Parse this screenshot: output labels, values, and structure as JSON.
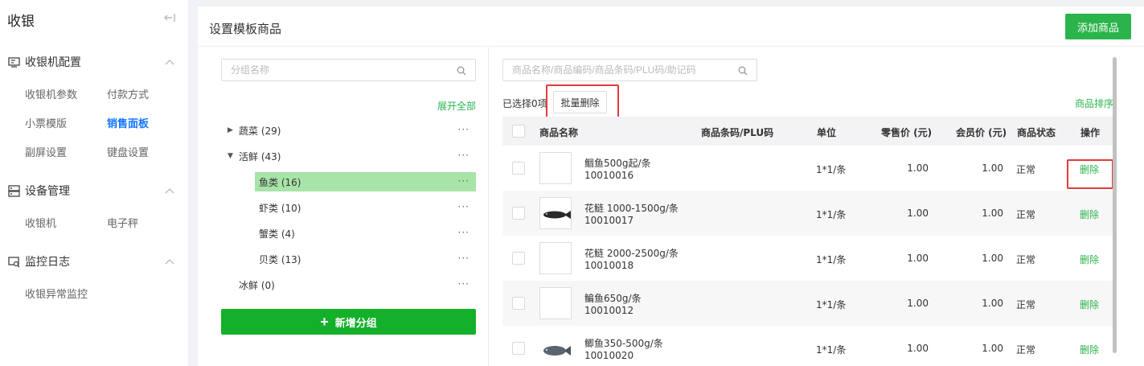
{
  "sidebar": {
    "title": "收银",
    "collapse_icon": "collapse-left-icon",
    "groups": [
      {
        "label": "收银机配置",
        "icon": "pos-config-icon",
        "items": [
          "收银机参数",
          "付款方式",
          "小票模版",
          "销售面板",
          "副屏设置",
          "键盘设置"
        ],
        "active": "销售面板"
      },
      {
        "label": "设备管理",
        "icon": "device-icon",
        "items": [
          "收银机",
          "电子秤"
        ]
      },
      {
        "label": "监控日志",
        "icon": "monitor-icon",
        "items": [
          "收银异常监控"
        ]
      }
    ]
  },
  "header": {
    "title": "设置模板商品",
    "add_button": "添加商品"
  },
  "group_panel": {
    "search_placeholder": "分组名称",
    "expand_all": "展开全部",
    "tree": [
      {
        "label": "蔬菜 (29)",
        "expanded": false
      },
      {
        "label": "活鲜 (43)",
        "expanded": true
      },
      {
        "label": "鱼类 (16)",
        "selected": true
      },
      {
        "label": "虾类 (10)"
      },
      {
        "label": "蟹类 (4)"
      },
      {
        "label": "贝类 (13)"
      },
      {
        "label": "冰鲜 (0)"
      }
    ],
    "more_symbol": "···",
    "new_group_button": "新增分组"
  },
  "product_panel": {
    "search_placeholder": "商品名称/商品编码/商品条码/PLU码/助记码",
    "selected_text": "已选择0项",
    "batch_delete": "批量删除",
    "sort_link": "商品排序",
    "columns": [
      "商品名称",
      "商品条码/PLU码",
      "单位",
      "零售价 (元)",
      "会员价 (元)",
      "商品状态",
      "操作"
    ],
    "rows": [
      {
        "name": "鲴鱼500g起/条",
        "code": "10010016",
        "unit": "1*1/条",
        "retail": "1.00",
        "member": "1.00",
        "status": "正常",
        "action": "删除",
        "image": "none"
      },
      {
        "name": "花鲢 1000-1500g/条",
        "code": "10010017",
        "unit": "1*1/条",
        "retail": "1.00",
        "member": "1.00",
        "status": "正常",
        "action": "删除",
        "image": "fish"
      },
      {
        "name": "花鲢 2000-2500g/条",
        "code": "10010018",
        "unit": "1*1/条",
        "retail": "1.00",
        "member": "1.00",
        "status": "正常",
        "action": "删除",
        "image": "none"
      },
      {
        "name": "鳊鱼650g/条",
        "code": "10010012",
        "unit": "1*1/条",
        "retail": "1.00",
        "member": "1.00",
        "status": "正常",
        "action": "删除",
        "image": "none"
      },
      {
        "name": "鲫鱼350-500g/条",
        "code": "10010020",
        "unit": "1*1/条",
        "retail": "1.00",
        "member": "1.00",
        "status": "正常",
        "action": "删除",
        "image": "fish"
      }
    ]
  },
  "colors": {
    "accent_green": "#2bb44b",
    "active_blue": "#1677ff",
    "highlight_red": "#e4393c",
    "selected_bg": "#a8e4a8"
  }
}
